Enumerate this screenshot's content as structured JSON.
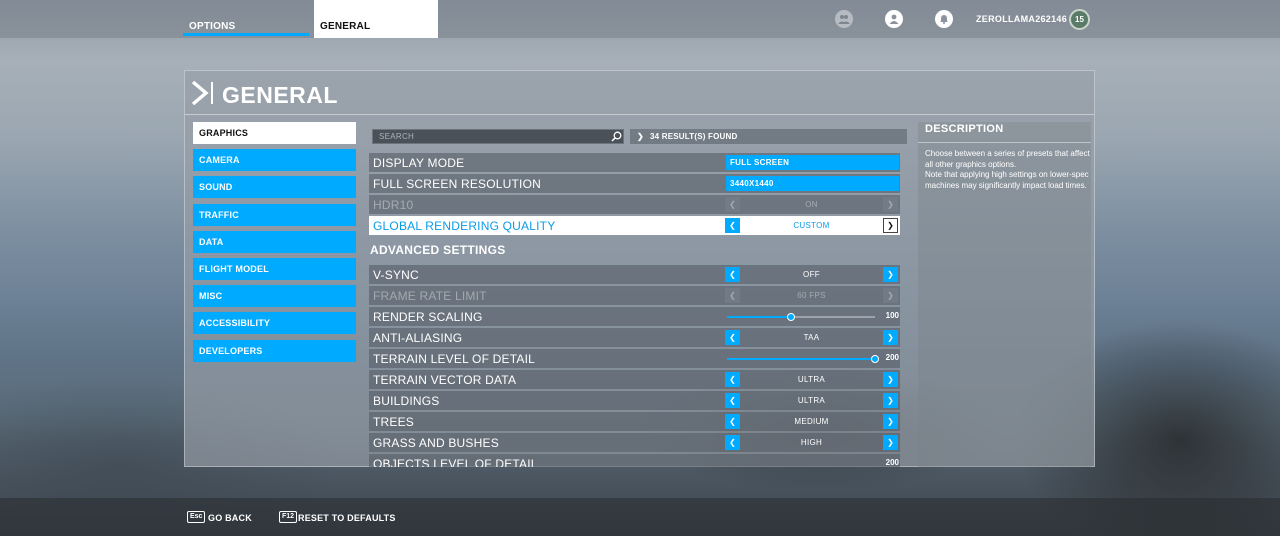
{
  "topbar": {
    "tabs": [
      {
        "label": "OPTIONS"
      },
      {
        "label": "GENERAL"
      }
    ],
    "icons": [
      "group-icon",
      "profile-icon",
      "notifications-icon"
    ],
    "username": "ZEROLLAMA262146",
    "level": "15"
  },
  "panel": {
    "title": "GENERAL"
  },
  "sidebar": {
    "items": [
      {
        "label": "GRAPHICS",
        "active": true
      },
      {
        "label": "CAMERA"
      },
      {
        "label": "SOUND"
      },
      {
        "label": "TRAFFIC"
      },
      {
        "label": "DATA"
      },
      {
        "label": "FLIGHT MODEL"
      },
      {
        "label": "MISC"
      },
      {
        "label": "ACCESSIBILITY"
      },
      {
        "label": "DEVELOPERS"
      }
    ]
  },
  "search": {
    "placeholder": "SEARCH",
    "results": "34 RESULT(S) FOUND"
  },
  "settings": {
    "display_mode": {
      "label": "DISPLAY MODE",
      "value": "FULL SCREEN"
    },
    "resolution": {
      "label": "FULL SCREEN RESOLUTION",
      "value": "3440X1440"
    },
    "hdr10": {
      "label": "HDR10",
      "value": "ON"
    },
    "global_quality": {
      "label": "GLOBAL RENDERING QUALITY",
      "value": "CUSTOM"
    },
    "advanced_heading": "ADVANCED SETTINGS",
    "vsync": {
      "label": "V-SYNC",
      "value": "OFF"
    },
    "frame_rate_limit": {
      "label": "FRAME RATE LIMIT",
      "value": "60 FPS"
    },
    "render_scaling": {
      "label": "RENDER SCALING",
      "value": "100",
      "fill_fraction": 0.43
    },
    "anti_aliasing": {
      "label": "ANTI-ALIASING",
      "value": "TAA"
    },
    "terrain_lod": {
      "label": "TERRAIN LEVEL OF DETAIL",
      "value": "200",
      "fill_fraction": 1.0
    },
    "terrain_vector": {
      "label": "TERRAIN VECTOR DATA",
      "value": "ULTRA"
    },
    "buildings": {
      "label": "BUILDINGS",
      "value": "ULTRA"
    },
    "trees": {
      "label": "TREES",
      "value": "MEDIUM"
    },
    "grass": {
      "label": "GRASS AND BUSHES",
      "value": "HIGH"
    },
    "objects_lod": {
      "label": "OBJECTS LEVEL OF DETAIL",
      "value": "200"
    }
  },
  "description": {
    "title": "DESCRIPTION",
    "text": "Choose between a series of presets that affect all other graphics options.\nNote that applying high settings on lower-spec machines may significantly impact load times."
  },
  "bottombar": {
    "go_back_key": "Esc",
    "go_back_label": "GO BACK",
    "reset_key": "F12",
    "reset_label": "RESET TO DEFAULTS"
  },
  "colors": {
    "accent": "#00aaff",
    "highlight_text": "#0a9bea"
  }
}
